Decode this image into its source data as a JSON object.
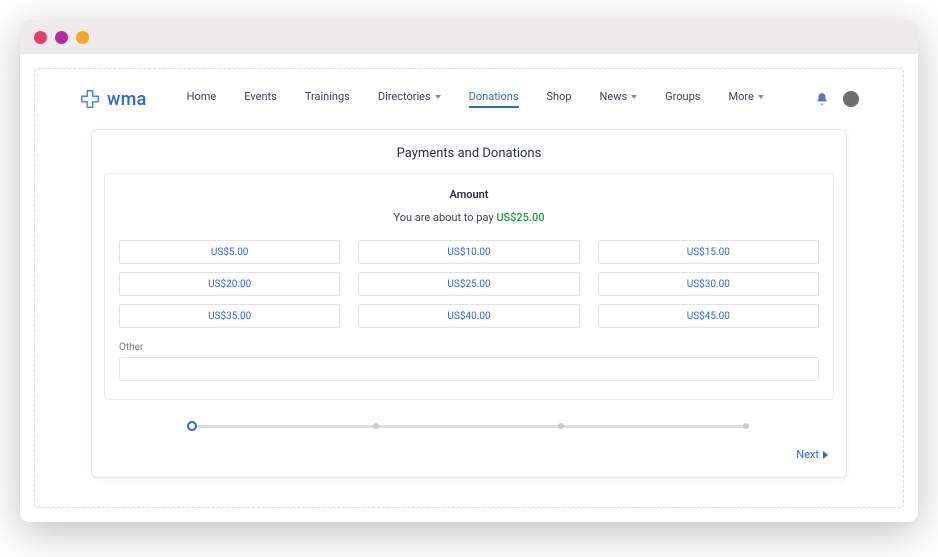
{
  "brand": {
    "name": "wma"
  },
  "nav": {
    "items": [
      {
        "label": "Home",
        "dropdown": false,
        "active": false
      },
      {
        "label": "Events",
        "dropdown": false,
        "active": false
      },
      {
        "label": "Trainings",
        "dropdown": false,
        "active": false
      },
      {
        "label": "Directories",
        "dropdown": true,
        "active": false
      },
      {
        "label": "Donations",
        "dropdown": false,
        "active": true
      },
      {
        "label": "Shop",
        "dropdown": false,
        "active": false
      },
      {
        "label": "News",
        "dropdown": true,
        "active": false
      },
      {
        "label": "Groups",
        "dropdown": false,
        "active": false
      },
      {
        "label": "More",
        "dropdown": true,
        "active": false
      }
    ]
  },
  "card": {
    "title": "Payments and Donations",
    "section_heading": "Amount",
    "pay_prefix": "You are about to pay ",
    "pay_amount": "US$25.00",
    "amounts": [
      "US$5.00",
      "US$10.00",
      "US$15.00",
      "US$20.00",
      "US$25.00",
      "US$30.00",
      "US$35.00",
      "US$40.00",
      "US$45.00"
    ],
    "other_label": "Other",
    "other_value": "",
    "next_label": "Next"
  },
  "progress": {
    "steps": 4,
    "current": 1
  },
  "colors": {
    "accent": "#2f66d6",
    "success": "#1b9e3f"
  }
}
